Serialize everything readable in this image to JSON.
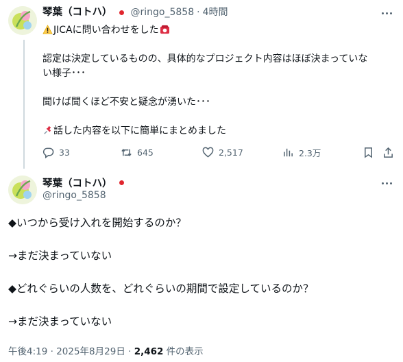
{
  "reply_tweet": {
    "author_name": "琴葉（コトハ）",
    "handle": "@ringo_5858",
    "time": "4時間",
    "lines": [
      "JICAに問い合わせをした",
      "",
      "認定は決定しているものの、具体的なプロジェクト内容はほぼ決まっていな",
      "い様子･･･",
      "",
      "聞けば聞くほど不安と疑念が湧いた･･･",
      "",
      "話した内容を以下に簡単にまとめました"
    ],
    "stats": {
      "replies": "33",
      "retweets": "645",
      "likes": "2,517",
      "views": "2.3万"
    }
  },
  "main_tweet": {
    "author_name": "琴葉（コトハ）",
    "handle": "@ringo_5858",
    "lines": [
      "◆いつから受け入れを開始するのか？",
      "",
      "→まだ決まっていない",
      "",
      "◆どれぐらいの人数を、どれぐらいの期間で設定しているのか？",
      "",
      "→まだ決まっていない"
    ],
    "timestamp": "午後4:19 · 2025年8月29日 · ",
    "view_count": "2,462",
    "view_suffix": " 件の表示"
  },
  "colors": {
    "text": "#0f1419",
    "muted": "#536471",
    "flag_red": "#e0262e",
    "thread_line": "#cfd9de"
  },
  "icons": {
    "warning": "warning-icon",
    "phone": "telephone-icon",
    "pin": "pushpin-icon",
    "reply": "reply-icon",
    "retweet": "retweet-icon",
    "like": "heart-icon",
    "views": "views-bar-icon",
    "bookmark": "bookmark-icon",
    "share": "share-icon",
    "more": "more-icon"
  }
}
